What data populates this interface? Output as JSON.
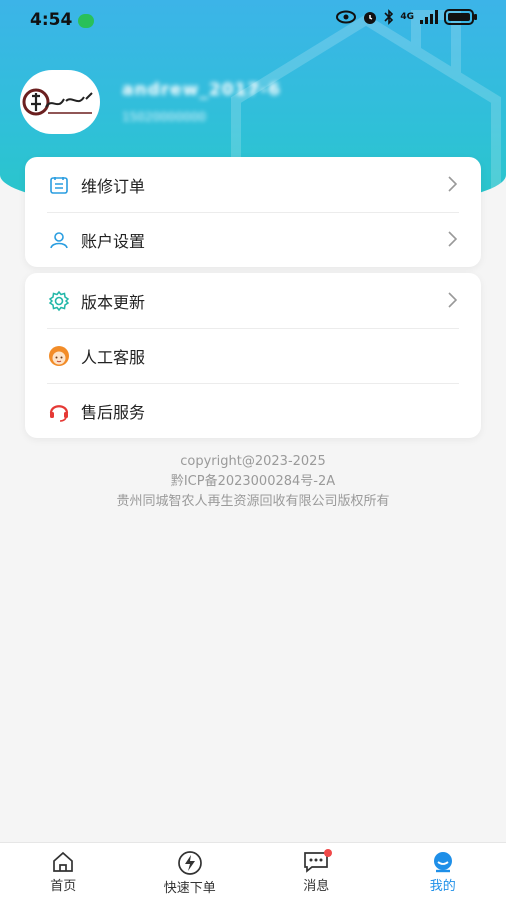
{
  "status_bar": {
    "time": "4:54",
    "network": "4G"
  },
  "profile": {
    "username": "andrew_2017-6",
    "user_id": "15020000000"
  },
  "menu_group1": [
    {
      "label": "维修订单",
      "icon": "clipboard-icon"
    },
    {
      "label": "账户设置",
      "icon": "user-icon"
    }
  ],
  "menu_group2": [
    {
      "label": "版本更新",
      "icon": "gear-icon"
    },
    {
      "label": "人工客服",
      "icon": "agent-avatar-icon"
    },
    {
      "label": "售后服务",
      "icon": "headset-icon"
    }
  ],
  "footer": {
    "copyright": "copyright@2023-2025",
    "icp": "黔ICP备2023000284号-2A",
    "company": "贵州同城智农人再生资源回收有限公司版权所有"
  },
  "tabs": [
    {
      "label": "首页",
      "icon": "home-icon"
    },
    {
      "label": "快速下单",
      "icon": "lightning-icon"
    },
    {
      "label": "消息",
      "icon": "chat-icon"
    },
    {
      "label": "我的",
      "icon": "profile-icon"
    }
  ],
  "colors": {
    "accent": "#1e8fe8",
    "header_start": "#3cb4e8",
    "header_end": "#28c7c8",
    "badge": "#f04848"
  }
}
